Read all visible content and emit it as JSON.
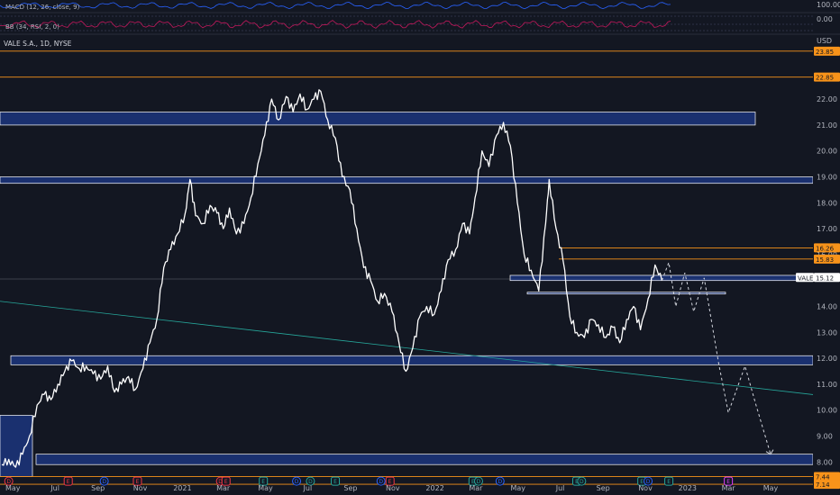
{
  "header": {
    "macd_label": "MACD (12, 26, close, 9)",
    "rsi_label": "BB (34, RSI, 2, 0)",
    "symbol_label": "VALE S.A., 1D, NYSE",
    "currency": "USD",
    "rsi_top_value": "100.00",
    "macd_value": "0.00"
  },
  "price_axis": {
    "ticks": [
      {
        "price": 22.0,
        "label": "22.00"
      },
      {
        "price": 21.0,
        "label": "21.00"
      },
      {
        "price": 20.0,
        "label": "20.00"
      },
      {
        "price": 19.0,
        "label": "19.00"
      },
      {
        "price": 18.0,
        "label": "18.00"
      },
      {
        "price": 17.0,
        "label": "17.00"
      },
      {
        "price": 16.0,
        "label": "16.00"
      },
      {
        "price": 14.0,
        "label": "14.00"
      },
      {
        "price": 13.0,
        "label": "13.00"
      },
      {
        "price": 12.0,
        "label": "12.00"
      },
      {
        "price": 11.0,
        "label": "11.00"
      },
      {
        "price": 10.0,
        "label": "10.00"
      },
      {
        "price": 9.0,
        "label": "9.00"
      },
      {
        "price": 8.0,
        "label": "8.00"
      }
    ],
    "tags": [
      {
        "price": 23.85,
        "label": "23.85",
        "color": "#f7931a",
        "text_color": "#131722"
      },
      {
        "price": 22.85,
        "label": "22.85",
        "color": "#f7931a",
        "text_color": "#131722"
      },
      {
        "price": 16.26,
        "label": "16.26",
        "color": "#f7931a",
        "text_color": "#131722"
      },
      {
        "price": 15.83,
        "label": "15.83",
        "color": "#f7931a",
        "text_color": "#131722"
      },
      {
        "price": 15.12,
        "label": "15.12",
        "color": "#ffffff",
        "text_color": "#131722",
        "prefix": "VALE"
      },
      {
        "price": 7.44,
        "label": "7.44",
        "color": "#f7931a",
        "text_color": "#131722"
      },
      {
        "price": 7.14,
        "label": "7.14",
        "color": "#f7931a",
        "text_color": "#131722"
      }
    ]
  },
  "time_axis": [
    "May",
    "Jul",
    "Sep",
    "Nov",
    "2021",
    "Mar",
    "May",
    "Jul",
    "Sep",
    "Nov",
    "2022",
    "Mar",
    "May",
    "Jul",
    "Sep",
    "Nov",
    "2023",
    "Mar",
    "May"
  ],
  "events": [
    {
      "type": "D",
      "color": "#f23645"
    },
    {
      "type": "E",
      "color": "#f23645"
    },
    {
      "type": "D",
      "color": "#2962ff"
    },
    {
      "type": "E",
      "color": "#f23645"
    },
    {
      "type": "D",
      "color": "#f23645"
    },
    {
      "type": "E",
      "color": "#f23645"
    },
    {
      "type": "E",
      "color": "#26a69a"
    },
    {
      "type": "D",
      "color": "#2962ff"
    },
    {
      "type": "D",
      "color": "#26a69a"
    },
    {
      "type": "E",
      "color": "#26a69a"
    },
    {
      "type": "D",
      "color": "#2962ff"
    },
    {
      "type": "E",
      "color": "#f23645"
    },
    {
      "type": "E",
      "color": "#26a69a"
    },
    {
      "type": "D",
      "color": "#26a69a"
    },
    {
      "type": "D",
      "color": "#2962ff"
    },
    {
      "type": "E",
      "color": "#26a69a"
    },
    {
      "type": "D",
      "color": "#26a69a"
    },
    {
      "type": "E",
      "color": "#26a69a"
    },
    {
      "type": "D",
      "color": "#2962ff"
    },
    {
      "type": "E",
      "color": "#26a69a"
    },
    {
      "type": "E",
      "color": "#e040fb"
    }
  ],
  "zones": [
    {
      "name": "zone-21",
      "top": 21.5,
      "bottom": 21.0
    },
    {
      "name": "zone-19",
      "top": 19.0,
      "bottom": 18.75
    },
    {
      "name": "zone-15",
      "top": 15.2,
      "bottom": 15.0
    },
    {
      "name": "zone-14-5",
      "top": 14.55,
      "bottom": 14.48
    },
    {
      "name": "zone-12",
      "top": 12.1,
      "bottom": 11.75
    },
    {
      "name": "zone-8",
      "top": 8.3,
      "bottom": 7.9
    },
    {
      "name": "zone-left",
      "top": 9.8,
      "bottom": 7.44
    }
  ],
  "colors": {
    "background": "#131722",
    "price_line": "#ffffff",
    "zone_fill": "#1e3a8a",
    "zone_stroke": "#ffffff",
    "level_line": "#f7931a",
    "trend_line": "#26a69a",
    "grid": "#1e222d",
    "axis_text": "#b2b5be"
  },
  "chart_data": {
    "type": "line",
    "ylabel": "USD",
    "ylim": [
      6.9,
      24.2
    ],
    "x_range": [
      "2020-04-15",
      "2023-05-31"
    ],
    "series": [
      {
        "name": "VALE",
        "points": [
          [
            "2020-04-15",
            7.9
          ],
          [
            "2020-04-25",
            8.1
          ],
          [
            "2020-05-05",
            7.8
          ],
          [
            "2020-05-15",
            8.3
          ],
          [
            "2020-05-25",
            9.0
          ],
          [
            "2020-06-05",
            10.2
          ],
          [
            "2020-06-15",
            10.6
          ],
          [
            "2020-06-25",
            10.4
          ],
          [
            "2020-07-05",
            11.0
          ],
          [
            "2020-07-15",
            11.5
          ],
          [
            "2020-07-25",
            11.9
          ],
          [
            "2020-08-05",
            11.6
          ],
          [
            "2020-08-15",
            11.7
          ],
          [
            "2020-08-25",
            11.4
          ],
          [
            "2020-09-05",
            11.2
          ],
          [
            "2020-09-15",
            11.7
          ],
          [
            "2020-09-25",
            10.7
          ],
          [
            "2020-10-05",
            11.0
          ],
          [
            "2020-10-15",
            11.3
          ],
          [
            "2020-10-25",
            10.8
          ],
          [
            "2020-11-05",
            11.6
          ],
          [
            "2020-11-15",
            12.6
          ],
          [
            "2020-11-25",
            13.5
          ],
          [
            "2020-12-05",
            15.5
          ],
          [
            "2020-12-15",
            16.2
          ],
          [
            "2020-12-25",
            16.8
          ],
          [
            "2021-01-05",
            17.6
          ],
          [
            "2021-01-12",
            18.9
          ],
          [
            "2021-01-20",
            17.5
          ],
          [
            "2021-01-31",
            17.2
          ],
          [
            "2021-02-10",
            17.9
          ],
          [
            "2021-02-20",
            17.6
          ],
          [
            "2021-03-01",
            17.0
          ],
          [
            "2021-03-10",
            17.8
          ],
          [
            "2021-03-20",
            16.8
          ],
          [
            "2021-03-31",
            17.2
          ],
          [
            "2021-04-10",
            18.2
          ],
          [
            "2021-04-20",
            19.5
          ],
          [
            "2021-04-30",
            20.6
          ],
          [
            "2021-05-10",
            22.0
          ],
          [
            "2021-05-20",
            21.2
          ],
          [
            "2021-05-31",
            22.1
          ],
          [
            "2021-06-10",
            21.5
          ],
          [
            "2021-06-20",
            22.2
          ],
          [
            "2021-06-30",
            21.6
          ],
          [
            "2021-07-10",
            22.0
          ],
          [
            "2021-07-20",
            22.3
          ],
          [
            "2021-07-30",
            21.2
          ],
          [
            "2021-08-10",
            20.5
          ],
          [
            "2021-08-20",
            19.0
          ],
          [
            "2021-08-31",
            18.5
          ],
          [
            "2021-09-10",
            17.0
          ],
          [
            "2021-09-20",
            15.5
          ],
          [
            "2021-09-30",
            15.0
          ],
          [
            "2021-10-10",
            14.2
          ],
          [
            "2021-10-20",
            14.5
          ],
          [
            "2021-10-31",
            13.8
          ],
          [
            "2021-11-10",
            12.6
          ],
          [
            "2021-11-20",
            11.5
          ],
          [
            "2021-11-30",
            12.4
          ],
          [
            "2021-12-10",
            13.6
          ],
          [
            "2021-12-20",
            14.0
          ],
          [
            "2021-12-31",
            13.7
          ],
          [
            "2022-01-10",
            14.6
          ],
          [
            "2022-01-20",
            15.8
          ],
          [
            "2022-01-31",
            16.2
          ],
          [
            "2022-02-10",
            17.2
          ],
          [
            "2022-02-20",
            16.8
          ],
          [
            "2022-02-28",
            18.2
          ],
          [
            "2022-03-10",
            20.0
          ],
          [
            "2022-03-20",
            19.4
          ],
          [
            "2022-03-31",
            20.6
          ],
          [
            "2022-04-10",
            21.1
          ],
          [
            "2022-04-20",
            20.2
          ],
          [
            "2022-04-30",
            18.0
          ],
          [
            "2022-05-10",
            16.0
          ],
          [
            "2022-05-20",
            15.4
          ],
          [
            "2022-05-31",
            14.6
          ],
          [
            "2022-06-10",
            17.2
          ],
          [
            "2022-06-15",
            18.9
          ],
          [
            "2022-06-25",
            17.0
          ],
          [
            "2022-07-05",
            15.8
          ],
          [
            "2022-07-15",
            13.6
          ],
          [
            "2022-07-25",
            13.0
          ],
          [
            "2022-08-05",
            12.8
          ],
          [
            "2022-08-15",
            13.5
          ],
          [
            "2022-08-25",
            13.3
          ],
          [
            "2022-09-05",
            12.8
          ],
          [
            "2022-09-15",
            13.2
          ],
          [
            "2022-09-25",
            12.6
          ],
          [
            "2022-10-05",
            13.5
          ],
          [
            "2022-10-15",
            14.0
          ],
          [
            "2022-10-25",
            13.1
          ],
          [
            "2022-11-05",
            14.3
          ],
          [
            "2022-11-15",
            15.6
          ],
          [
            "2022-11-25",
            15.0
          ]
        ]
      },
      {
        "name": "projection",
        "points": [
          [
            "2022-11-25",
            15.0
          ],
          [
            "2022-12-05",
            15.7
          ],
          [
            "2022-12-15",
            14.0
          ],
          [
            "2022-12-28",
            15.3
          ],
          [
            "2023-01-10",
            13.8
          ],
          [
            "2023-01-25",
            15.1
          ],
          [
            "2023-02-15",
            11.8
          ],
          [
            "2023-03-01",
            9.9
          ],
          [
            "2023-03-25",
            11.7
          ],
          [
            "2023-04-10",
            10.2
          ],
          [
            "2023-05-01",
            8.3
          ]
        ]
      }
    ],
    "levels": [
      23.85,
      22.85,
      16.26,
      15.83,
      7.44,
      7.14
    ],
    "trend_line": [
      [
        "2020-04-15",
        14.2
      ],
      [
        "2023-05-31",
        10.6
      ]
    ],
    "grid": false
  }
}
